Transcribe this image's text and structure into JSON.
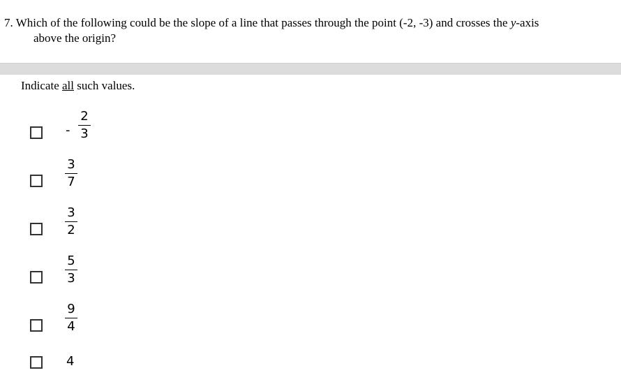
{
  "question": {
    "number": "7.",
    "text_line1": "Which of the following could be the slope of a line that passes through the point (-2, -3) and crosses the",
    "var_y": "y",
    "text_line1_end": "-axis",
    "text_line2": "above the origin?"
  },
  "instruction": {
    "before": "Indicate ",
    "underlined": "all",
    "after": " such values."
  },
  "choices": [
    {
      "sign": "-",
      "numerator": "2",
      "denominator": "3"
    },
    {
      "sign": "",
      "numerator": "3",
      "denominator": "7"
    },
    {
      "sign": "",
      "numerator": "3",
      "denominator": "2"
    },
    {
      "sign": "",
      "numerator": "5",
      "denominator": "3"
    },
    {
      "sign": "",
      "numerator": "9",
      "denominator": "4"
    },
    {
      "whole": "4"
    }
  ]
}
